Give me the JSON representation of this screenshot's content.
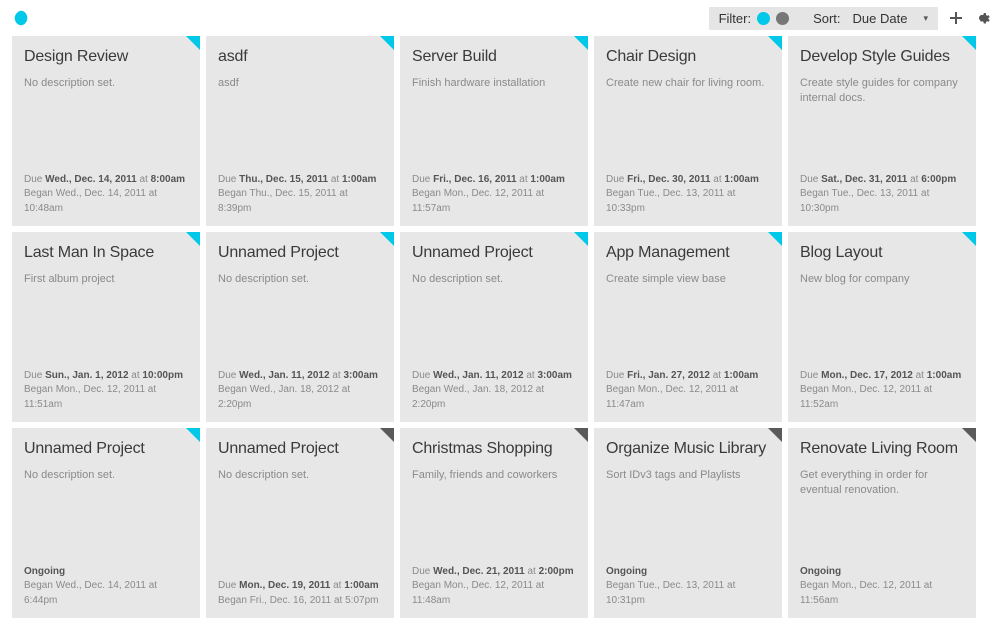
{
  "colors": {
    "accent": "#00c8e8",
    "muted": "#777"
  },
  "toolbar": {
    "filter_label": "Filter:",
    "sort_label": "Sort:",
    "sort_value": "Due Date"
  },
  "due_label": "Due",
  "began_label": "Began",
  "at_label": "at",
  "ongoing_label": "Ongoing",
  "cards": [
    {
      "title": "Design Review",
      "desc": "No description set.",
      "due_date": "Wed., Dec. 14, 2011",
      "due_time": "8:00am",
      "began": "Wed., Dec. 14, 2011 at 10:48am",
      "corner": "cyan"
    },
    {
      "title": "asdf",
      "desc": "asdf",
      "due_date": "Thu., Dec. 15, 2011",
      "due_time": "1:00am",
      "began": "Thu., Dec. 15, 2011 at 8:39pm",
      "corner": "cyan"
    },
    {
      "title": "Server Build",
      "desc": "Finish hardware installation",
      "due_date": "Fri., Dec. 16, 2011",
      "due_time": "1:00am",
      "began": "Mon., Dec. 12, 2011 at 11:57am",
      "corner": "cyan"
    },
    {
      "title": "Chair Design",
      "desc": "Create new chair for living room.",
      "due_date": "Fri., Dec. 30, 2011",
      "due_time": "1:00am",
      "began": "Tue., Dec. 13, 2011 at 10:33pm",
      "corner": "cyan"
    },
    {
      "title": "Develop Style Guides",
      "desc": "Create style guides for company internal docs.",
      "due_date": "Sat., Dec. 31, 2011",
      "due_time": "6:00pm",
      "began": "Tue., Dec. 13, 2011 at 10:30pm",
      "corner": "cyan"
    },
    {
      "title": "Last Man In Space",
      "desc": "First album project",
      "due_date": "Sun., Jan. 1, 2012",
      "due_time": "10:00pm",
      "began": "Mon., Dec. 12, 2011 at 11:51am",
      "corner": "cyan"
    },
    {
      "title": "Unnamed Project",
      "desc": "No description set.",
      "due_date": "Wed., Jan. 11, 2012",
      "due_time": "3:00am",
      "began": "Wed., Jan. 18, 2012 at 2:20pm",
      "corner": "cyan"
    },
    {
      "title": "Unnamed Project",
      "desc": "No description set.",
      "due_date": "Wed., Jan. 11, 2012",
      "due_time": "3:00am",
      "began": "Wed., Jan. 18, 2012 at 2:20pm",
      "corner": "cyan"
    },
    {
      "title": "App Management",
      "desc": "Create simple view base",
      "due_date": "Fri., Jan. 27, 2012",
      "due_time": "1:00am",
      "began": "Mon., Dec. 12, 2011 at 11:47am",
      "corner": "cyan"
    },
    {
      "title": "Blog Layout",
      "desc": "New blog for company",
      "due_date": "Mon., Dec. 17, 2012",
      "due_time": "1:00am",
      "began": "Mon., Dec. 12, 2011 at 11:52am",
      "corner": "cyan"
    },
    {
      "title": "Unnamed Project",
      "desc": "No description set.",
      "ongoing": true,
      "began": "Wed., Dec. 14, 2011 at 6:44pm",
      "corner": "cyan"
    },
    {
      "title": "Unnamed Project",
      "desc": "No description set.",
      "due_date": "Mon., Dec. 19, 2011",
      "due_time": "1:00am",
      "began": "Fri., Dec. 16, 2011 at 5:07pm",
      "corner": "grey"
    },
    {
      "title": "Christmas Shopping",
      "desc": "Family, friends and coworkers",
      "due_date": "Wed., Dec. 21, 2011",
      "due_time": "2:00pm",
      "began": "Mon., Dec. 12, 2011 at 11:48am",
      "corner": "grey"
    },
    {
      "title": "Organize Music Library",
      "desc": "Sort IDv3 tags and Playlists",
      "ongoing": true,
      "began": "Tue., Dec. 13, 2011 at 10:31pm",
      "corner": "grey"
    },
    {
      "title": "Renovate Living Room",
      "desc": "Get everything in order for eventual renovation.",
      "ongoing": true,
      "began": "Mon., Dec. 12, 2011 at 11:56am",
      "corner": "grey"
    }
  ]
}
